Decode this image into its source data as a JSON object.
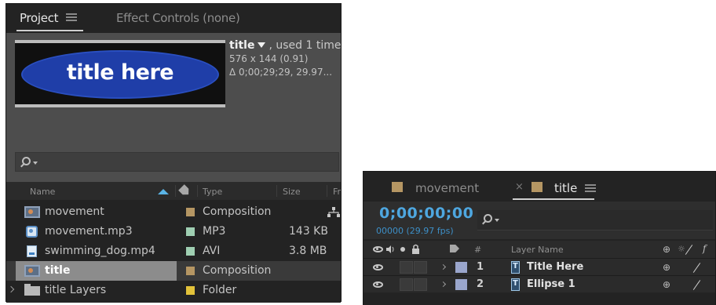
{
  "project_panel": {
    "tabs": [
      {
        "label": "Project"
      },
      {
        "label": "Effect Controls (none)"
      }
    ],
    "thumbnail_text": "title here",
    "info": {
      "name": "title",
      "used": ", used 1 time",
      "dimensions": "576 x 144 (0.91)",
      "duration": "Δ 0;00;29;29, 29.97..."
    },
    "columns": {
      "name": "Name",
      "type": "Type",
      "size": "Size",
      "frame_rate": "Fr"
    },
    "items": [
      {
        "name": "movement",
        "type": "Composition",
        "size": "",
        "icon": "composition-icon",
        "label_color": "#b59663"
      },
      {
        "name": "movement.mp3",
        "type": "MP3",
        "size": "143 KB",
        "icon": "audio-file-icon",
        "label_color": "#9fcfb2"
      },
      {
        "name": "swimming_dog.mp4",
        "type": "AVI",
        "size": "3.8 MB",
        "icon": "video-file-icon",
        "label_color": "#9fcfb2"
      },
      {
        "name": "title",
        "type": "Composition",
        "size": "",
        "icon": "composition-icon",
        "label_color": "#b59663",
        "selected": true
      },
      {
        "name": "title Layers",
        "type": "Folder",
        "size": "",
        "icon": "folder-icon",
        "label_color": "#e2c23a"
      }
    ]
  },
  "timeline_panel": {
    "tabs": [
      {
        "label": "movement"
      },
      {
        "label": "title"
      }
    ],
    "close_glyph": "×",
    "timecode": "0;00;00;00",
    "frames": "00000 (29.97 fps)",
    "columns": {
      "number": "#",
      "layer_name": "Layer Name"
    },
    "layers": [
      {
        "number": "1",
        "name": "Title Here",
        "label_color": "#9aa6cc"
      },
      {
        "number": "2",
        "name": "Ellipse 1",
        "label_color": "#9aa6cc"
      }
    ]
  },
  "colors": {
    "accent_blue": "#4ea7e0",
    "ellipse_blue": "#1f3ea8"
  }
}
